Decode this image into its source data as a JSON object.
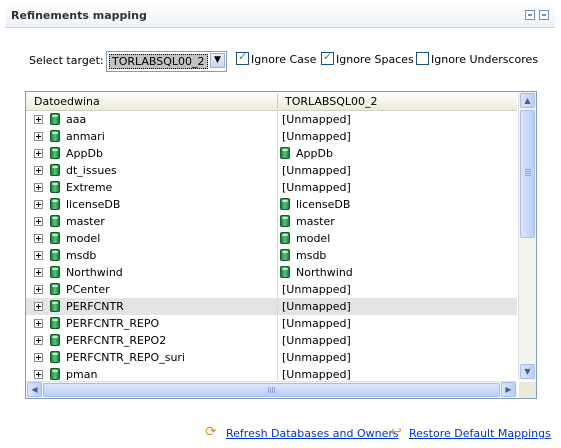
{
  "panel": {
    "title": "Refinements mapping"
  },
  "target": {
    "label": "Select target:",
    "selected": "TORLABSQL00_2"
  },
  "options": [
    {
      "label": "Ignore Case",
      "checked": true
    },
    {
      "label": "Ignore Spaces",
      "checked": true
    },
    {
      "label": "Ignore Underscores",
      "checked": false
    }
  ],
  "grid": {
    "columns": [
      "Datoedwina",
      "TORLABSQL00_2"
    ],
    "rows": [
      {
        "name": "aaa",
        "mapped": "[Unmapped]"
      },
      {
        "name": "anmari",
        "mapped": "[Unmapped]"
      },
      {
        "name": "AppDb",
        "mapped": "AppDb"
      },
      {
        "name": "dt_issues",
        "mapped": "[Unmapped]"
      },
      {
        "name": "Extreme",
        "mapped": "[Unmapped]"
      },
      {
        "name": "licenseDB",
        "mapped": "licenseDB"
      },
      {
        "name": "master",
        "mapped": "master"
      },
      {
        "name": "model",
        "mapped": "model"
      },
      {
        "name": "msdb",
        "mapped": "msdb"
      },
      {
        "name": "Northwind",
        "mapped": "Northwind"
      },
      {
        "name": "PCenter",
        "mapped": "[Unmapped]"
      },
      {
        "name": "PERFCNTR",
        "mapped": "[Unmapped]"
      },
      {
        "name": "PERFCNTR_REPO",
        "mapped": "[Unmapped]"
      },
      {
        "name": "PERFCNTR_REPO2",
        "mapped": "[Unmapped]"
      },
      {
        "name": "PERFCNTR_REPO_suri",
        "mapped": "[Unmapped]"
      },
      {
        "name": "pman",
        "mapped": "[Unmapped]"
      }
    ]
  },
  "links": {
    "refresh": "Refresh Databases and Owners",
    "restore": "Restore Default Mappings"
  },
  "colors": {
    "link": "#0033cc",
    "db_icon": "#2e9b4f",
    "header_border": "#c8d3e4"
  }
}
